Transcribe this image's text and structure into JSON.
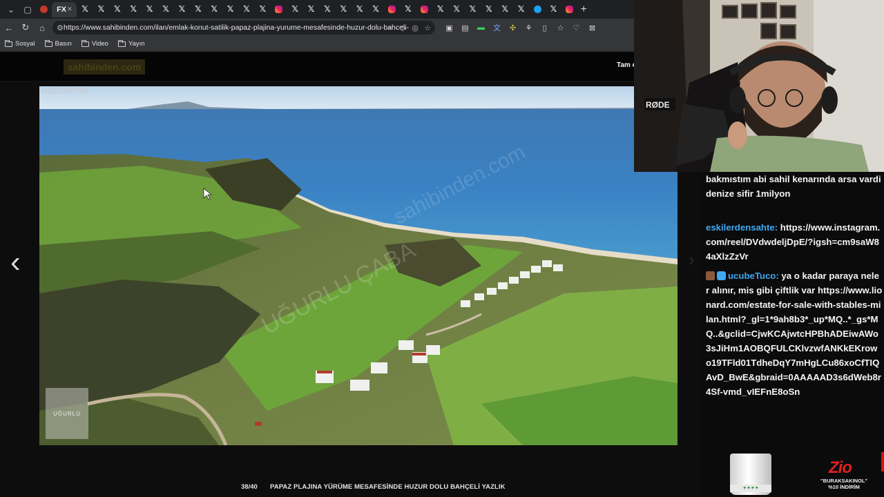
{
  "browser": {
    "tab_count_x": 24,
    "active_tab_label": "FX",
    "url": "https://www.sahibinden.com/ilan/emlak-konut-satilik-papaz-plajina-yurume-mesafesinde-huzur-dolu-bahceli-yazlik-1...",
    "bookmarks": [
      {
        "label": "Sosyal"
      },
      {
        "label": "Basın"
      },
      {
        "label": "Video"
      },
      {
        "label": "Yayın"
      }
    ]
  },
  "site": {
    "logo_text": "sahibinden.com",
    "fullscreen_label": "Tam e"
  },
  "lightbox": {
    "photo_id": "#1312517759",
    "counter": "38/40",
    "caption": "PAPAZ PLAJINA YÜRÜME MESAFESİNDE HUZUR DOLU BAHÇELİ YAZLIK",
    "thumb_text": "UĞURLU"
  },
  "chat": {
    "messages": [
      {
        "user": "",
        "text": "bakmıstım abi sahil kenarında arsa vardi denize sifir 1milyon"
      },
      {
        "user": "eskilerdensahte:",
        "text": "https://www.instagram.com/reel/DVdwdeljDpE/?igsh=cm9saW84aXlzZzVr"
      },
      {
        "user": "ucubeTuco:",
        "text": "ya o kadar paraya neler alınır, mis gibi çiftlik var https://www.lionard.com/estate-for-sale-with-stables-milan.html?_gl=1*9ah8b3*_up*MQ..*_gs*MQ..&gclid=CjwKCAjwtcHPBhADEiwAWo3sJiHm1AOBQFULCKlvzwfANKkEKrowo19TFld01TdheDqY7mHgLCu86xoCfTIQAvD_BwE&gbraid=0AAAAAD3s6dWeb8r4Sf-vmd_vIEFnE8oSn"
      }
    ]
  },
  "sponsor": {
    "brand": "Zio",
    "code_text": "\"BURAKSAKINOL\" %10 İNDİRİM"
  },
  "colors": {
    "chat_username": "#3fa9f5",
    "sponsor_red": "#e02020"
  }
}
